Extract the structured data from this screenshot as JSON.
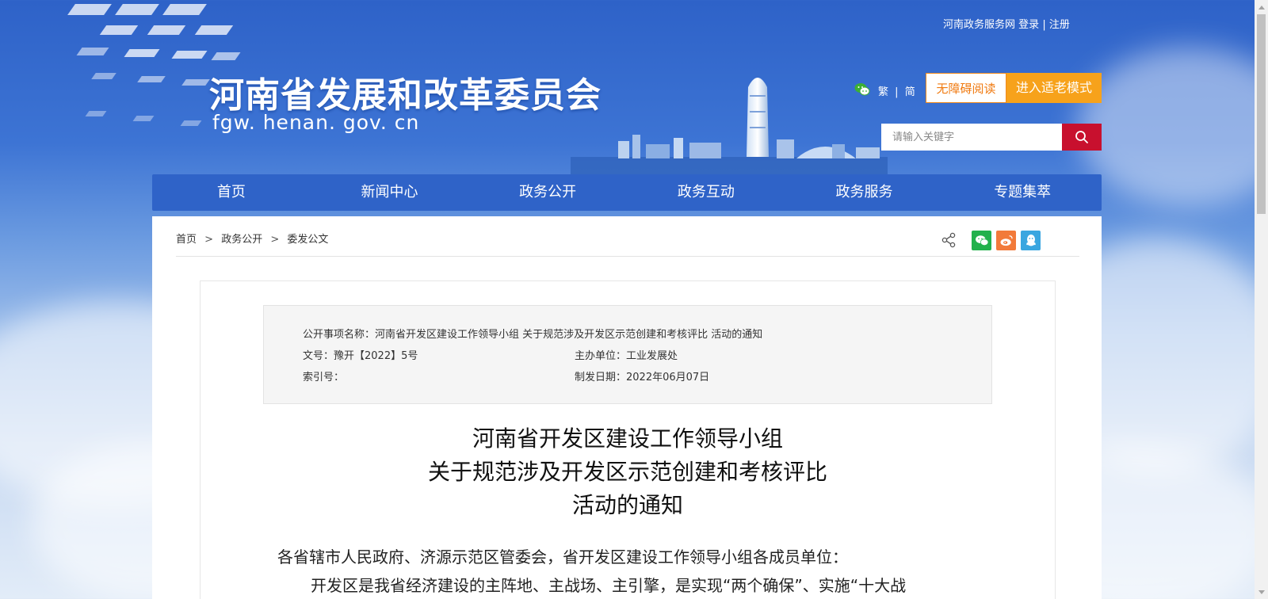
{
  "header": {
    "top_links": {
      "portal": "河南政务服务网",
      "login": "登录",
      "divider": "|",
      "register": "注册"
    },
    "site_title": "河南省发展和改革委员会",
    "site_domain": "fgw. henan. gov. cn",
    "lang": {
      "traditional": "繁",
      "divider": "|",
      "simplified": "简"
    },
    "accessibility_btn": "无障碍阅读",
    "elder_mode_btn": "进入适老模式",
    "search": {
      "placeholder": "请输入关键字"
    }
  },
  "nav": {
    "items": [
      "首页",
      "新闻中心",
      "政务公开",
      "政务互动",
      "政务服务",
      "专题集萃"
    ]
  },
  "breadcrumb": {
    "items": [
      "首页",
      "政务公开",
      "委发公文"
    ],
    "sep": ">"
  },
  "meta": {
    "item_name": "公开事项名称：河南省开发区建设工作领导小组 关于规范涉及开发区示范创建和考核评比 活动的通知",
    "doc_no": "文号：豫开【2022】5号",
    "dept": "主办单位：工业发展处",
    "index_no": "索引号：",
    "date": "制发日期：2022年06月07日"
  },
  "article": {
    "title_lines": [
      "河南省开发区建设工作领导小组",
      "关于规范涉及开发区示范创建和考核评比",
      "活动的通知"
    ],
    "salutation": "各省辖市人民政府、济源示范区管委会，省开发区建设工作领导小组各成员单位：",
    "para1_start": "开发区是我省经济建设的主阵地、主战场、主引擎，是实现“两个确保”、实施“十大战"
  },
  "colors": {
    "nav_bg": "#2f63c8",
    "search_btn": "#c8102e",
    "elder_btn": "#f7a21b",
    "accessibility_border": "#f08a1c",
    "wechat": "#22b14c",
    "weibo": "#f27a3a",
    "qq": "#3aa6e0"
  }
}
